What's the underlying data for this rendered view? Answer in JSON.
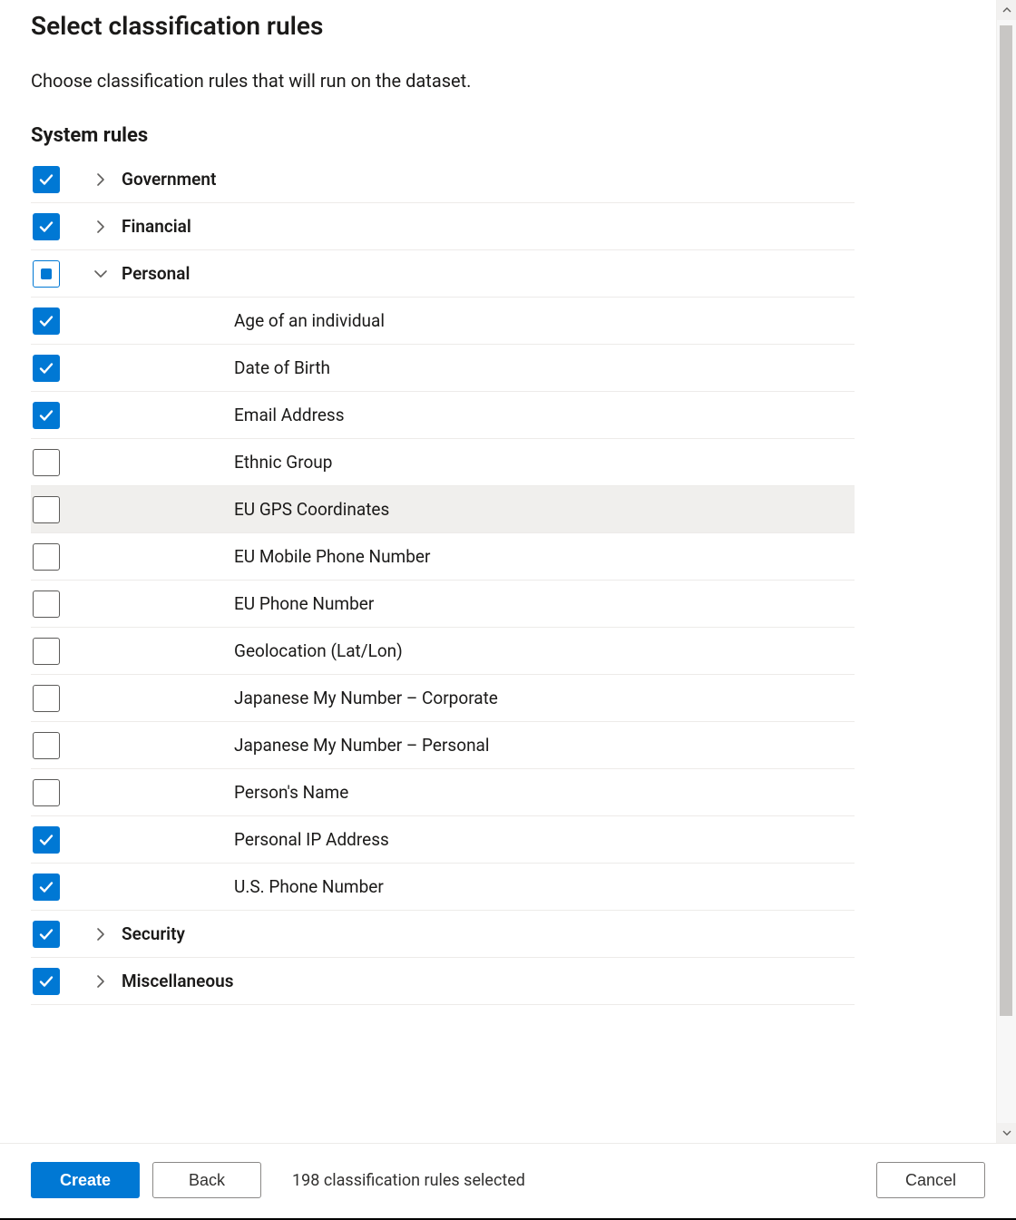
{
  "header": {
    "title": "Select classification rules",
    "subtitle": "Choose classification rules that will run on the dataset."
  },
  "section_title": "System rules",
  "groups": [
    {
      "id": "government",
      "label": "Government",
      "state": "checked",
      "expanded": false,
      "children": []
    },
    {
      "id": "financial",
      "label": "Financial",
      "state": "checked",
      "expanded": false,
      "children": []
    },
    {
      "id": "personal",
      "label": "Personal",
      "state": "indeterminate",
      "expanded": true,
      "children": [
        {
          "id": "age",
          "label": "Age of an individual",
          "checked": true
        },
        {
          "id": "dob",
          "label": "Date of Birth",
          "checked": true
        },
        {
          "id": "email",
          "label": "Email Address",
          "checked": true
        },
        {
          "id": "ethnic",
          "label": "Ethnic Group",
          "checked": false
        },
        {
          "id": "eu-gps",
          "label": "EU GPS Coordinates",
          "checked": false,
          "highlight": true
        },
        {
          "id": "eu-mobile",
          "label": "EU Mobile Phone Number",
          "checked": false
        },
        {
          "id": "eu-phone",
          "label": "EU Phone Number",
          "checked": false
        },
        {
          "id": "geo",
          "label": "Geolocation (Lat/Lon)",
          "checked": false
        },
        {
          "id": "jp-corp",
          "label": "Japanese My Number – Corporate",
          "checked": false
        },
        {
          "id": "jp-pers",
          "label": "Japanese My Number – Personal",
          "checked": false
        },
        {
          "id": "person-name",
          "label": "Person's Name",
          "checked": false
        },
        {
          "id": "ip",
          "label": "Personal IP Address",
          "checked": true
        },
        {
          "id": "us-phone",
          "label": "U.S. Phone Number",
          "checked": true
        }
      ]
    },
    {
      "id": "security",
      "label": "Security",
      "state": "checked",
      "expanded": false,
      "children": []
    },
    {
      "id": "miscellaneous",
      "label": "Miscellaneous",
      "state": "checked",
      "expanded": false,
      "children": []
    }
  ],
  "footer": {
    "create_label": "Create",
    "back_label": "Back",
    "cancel_label": "Cancel",
    "status": "198 classification rules selected"
  }
}
